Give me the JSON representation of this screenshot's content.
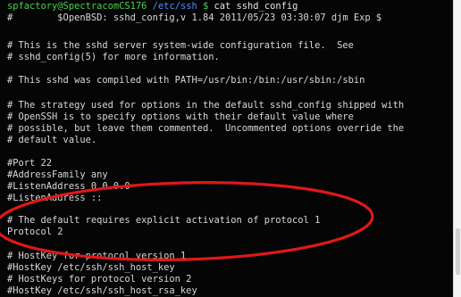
{
  "prompt": {
    "user_host": "spfactory@SpectracomCS176",
    "path": "/etc/ssh",
    "symbol": "$",
    "command": "cat sshd_config"
  },
  "lines": [
    "#        $OpenBSD: sshd_config,v 1.84 2011/05/23 03:30:07 djm Exp $",
    "",
    "# This is the sshd server system-wide configuration file.  See",
    "# sshd_config(5) for more information.",
    "",
    "# This sshd was compiled with PATH=/usr/bin:/bin:/usr/sbin:/sbin",
    "",
    "# The strategy used for options in the default sshd_config shipped with",
    "# OpenSSH is to specify options with their default value where",
    "# possible, but leave them commented.  Uncommented options override the",
    "# default value.",
    "",
    "#Port 22",
    "#AddressFamily any",
    "#ListenAddress 0.0.0.0",
    "#ListenAddress ::",
    "",
    "# The default requires explicit activation of protocol 1",
    "Protocol 2",
    "",
    "# HostKey for protocol version 1",
    "#HostKey /etc/ssh/ssh_host_key",
    "# HostKeys for protocol version 2",
    "#HostKey /etc/ssh/ssh_host_rsa_key"
  ],
  "annotation": {
    "color": "#e01818"
  }
}
